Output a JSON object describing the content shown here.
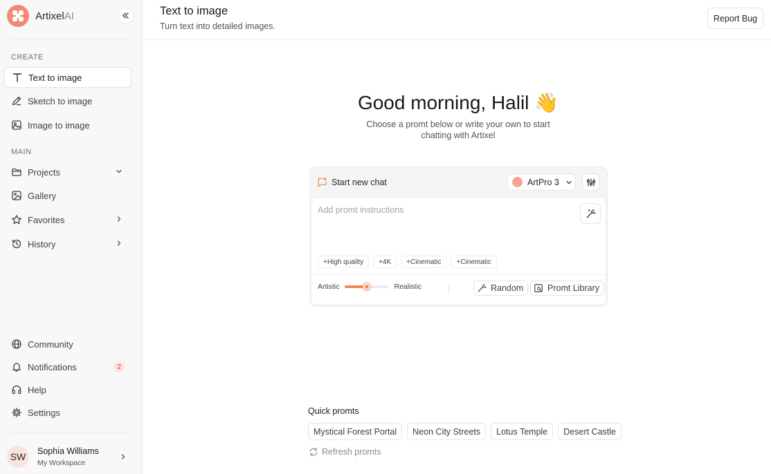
{
  "brand": {
    "name": "Artixel",
    "suffix": "AI"
  },
  "sidebar": {
    "create_label": "CREATE",
    "create_items": [
      {
        "label": "Text to image",
        "icon": "text-icon",
        "active": true
      },
      {
        "label": "Sketch to image",
        "icon": "pen-icon"
      },
      {
        "label": "Image to image",
        "icon": "image-icon"
      }
    ],
    "main_label": "MAIN",
    "main_items": [
      {
        "label": "Projects",
        "icon": "folder-icon",
        "chevron": "down"
      },
      {
        "label": "Gallery",
        "icon": "gallery-icon"
      },
      {
        "label": "Favorites",
        "icon": "star-icon",
        "chevron": "right"
      },
      {
        "label": "History",
        "icon": "history-icon",
        "chevron": "right"
      }
    ],
    "bottom_items": [
      {
        "label": "Community",
        "icon": "globe-icon"
      },
      {
        "label": "Notifications",
        "icon": "bell-icon",
        "badge": "2"
      },
      {
        "label": "Help",
        "icon": "headset-icon"
      },
      {
        "label": "Settings",
        "icon": "gear-icon"
      }
    ],
    "user": {
      "initials": "SW",
      "name": "Sophia Williams",
      "workspace": "My Workspace"
    }
  },
  "header": {
    "title": "Text to image",
    "subtitle": "Turn text into detailed images.",
    "report_label": "Report Bug"
  },
  "hero": {
    "greeting": "Good morning, Halil 👋",
    "subtitle": "Choose a promt below or write your own to start chatting with Artixel"
  },
  "composer": {
    "new_chat_label": "Start new chat",
    "model": "ArtPro 3",
    "placeholder": "Add promt instructions",
    "chips": [
      "+High quality",
      "+4K",
      "+Cinematic",
      "+Cinematic"
    ],
    "slider": {
      "left_label": "Artistic",
      "right_label": "Realistic",
      "value": 0.5
    },
    "random_label": "Random",
    "library_label": "Promt Library"
  },
  "quick_prompts": {
    "title": "Quick promts",
    "items": [
      "Mystical Forest Portal",
      "Neon City Streets",
      "Lotus Temple",
      "Desert Castle"
    ],
    "refresh_label": "Refresh promts"
  },
  "colors": {
    "accent": "#f08a73",
    "slider": "#f08a5d",
    "badge_bg": "#fde4e0"
  }
}
